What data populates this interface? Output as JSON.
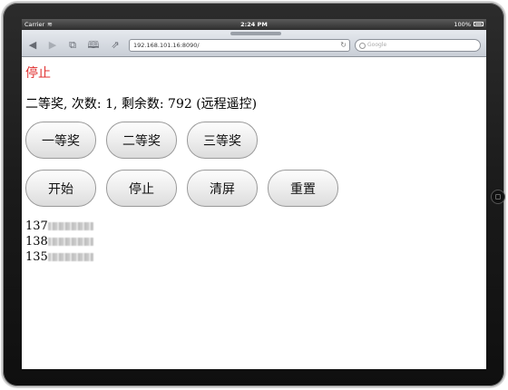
{
  "status_bar": {
    "carrier": "Carrier",
    "time": "2:24 PM",
    "battery": "100%"
  },
  "browser": {
    "url": "192.168.101.16:8090/",
    "search_placeholder": "Google"
  },
  "page": {
    "status_text": "停止",
    "status_color": "#e03030",
    "info_line": "二等奖, 次数: 1, 剩余数: 792 (远程遥控)",
    "prize_buttons": [
      "一等奖",
      "二等奖",
      "三等奖"
    ],
    "control_buttons": [
      "开始",
      "停止",
      "清屏",
      "重置"
    ],
    "results": [
      "137",
      "138",
      "135"
    ]
  },
  "icons": {
    "back": "back-arrow-icon",
    "forward": "forward-arrow-icon",
    "pages": "pages-icon",
    "bookmarks": "bookmarks-icon",
    "share": "share-icon",
    "reload": "reload-icon",
    "search": "search-icon"
  }
}
